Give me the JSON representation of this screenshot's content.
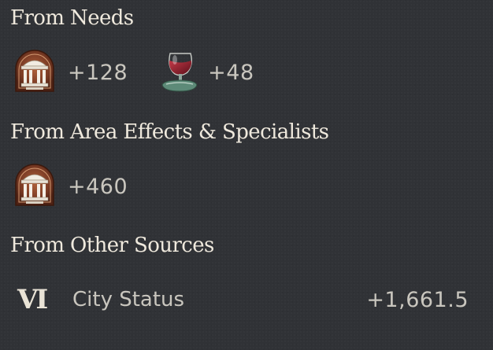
{
  "sections": [
    {
      "heading": "From Needs",
      "items": [
        {
          "icon": "rotunda-temple-icon",
          "value": "+128"
        },
        {
          "icon": "wine-glass-icon",
          "value": "+48"
        }
      ]
    },
    {
      "heading": "From Area Effects & Specialists",
      "items": [
        {
          "icon": "rotunda-temple-icon",
          "value": "+460"
        }
      ]
    },
    {
      "heading": "From Other Sources",
      "items": [
        {
          "icon_text": "VI",
          "label": "City Status",
          "value": "+1,661.5"
        }
      ]
    }
  ],
  "colors": {
    "background": "#303236",
    "heading": "#efe9dd",
    "value": "#c9c6be",
    "icon_frame": "#7a3b24",
    "wine": "#8c1f2c"
  }
}
